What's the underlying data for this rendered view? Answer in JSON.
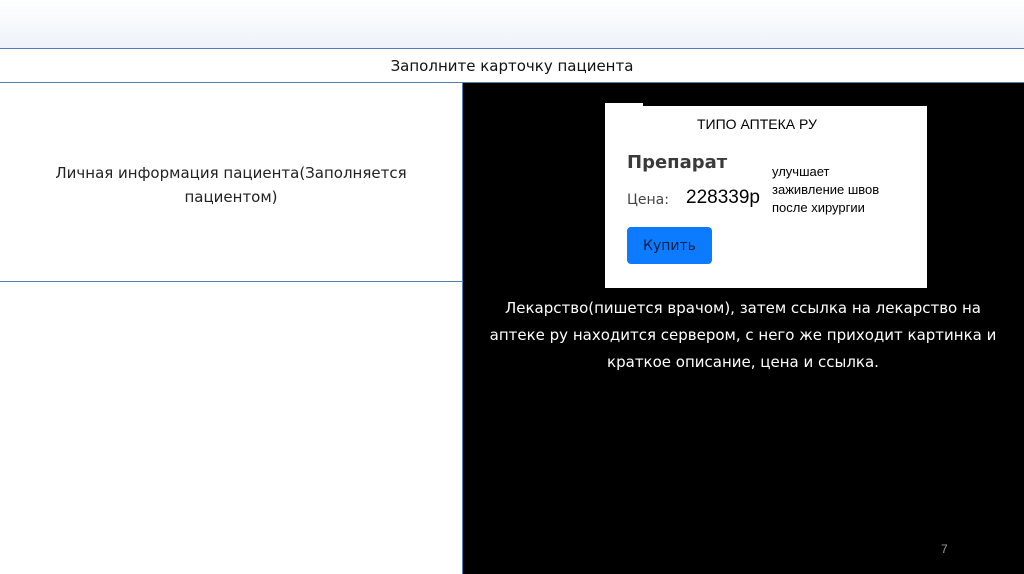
{
  "header": {
    "title": "Заполните карточку пациента"
  },
  "left_panel": {
    "info_text": "Личная информация пациента(Заполняется пациентом)"
  },
  "product_card": {
    "site_name": "ТИПО АПТЕКА РУ",
    "product_name": "Препарат",
    "price_label": "Цена:",
    "price_value": "228339р",
    "description": "улучшает заживление швов после хирургии",
    "buy_button_label": "Купить",
    "button_color": "#0d7bff"
  },
  "right_panel": {
    "description": "Лекарство(пишется врачом), затем ссылка на лекарство на аптеке ру находится сервером, с него же приходит картинка и краткое описание, цена и ссылка."
  },
  "footer": {
    "page_number": "7"
  }
}
